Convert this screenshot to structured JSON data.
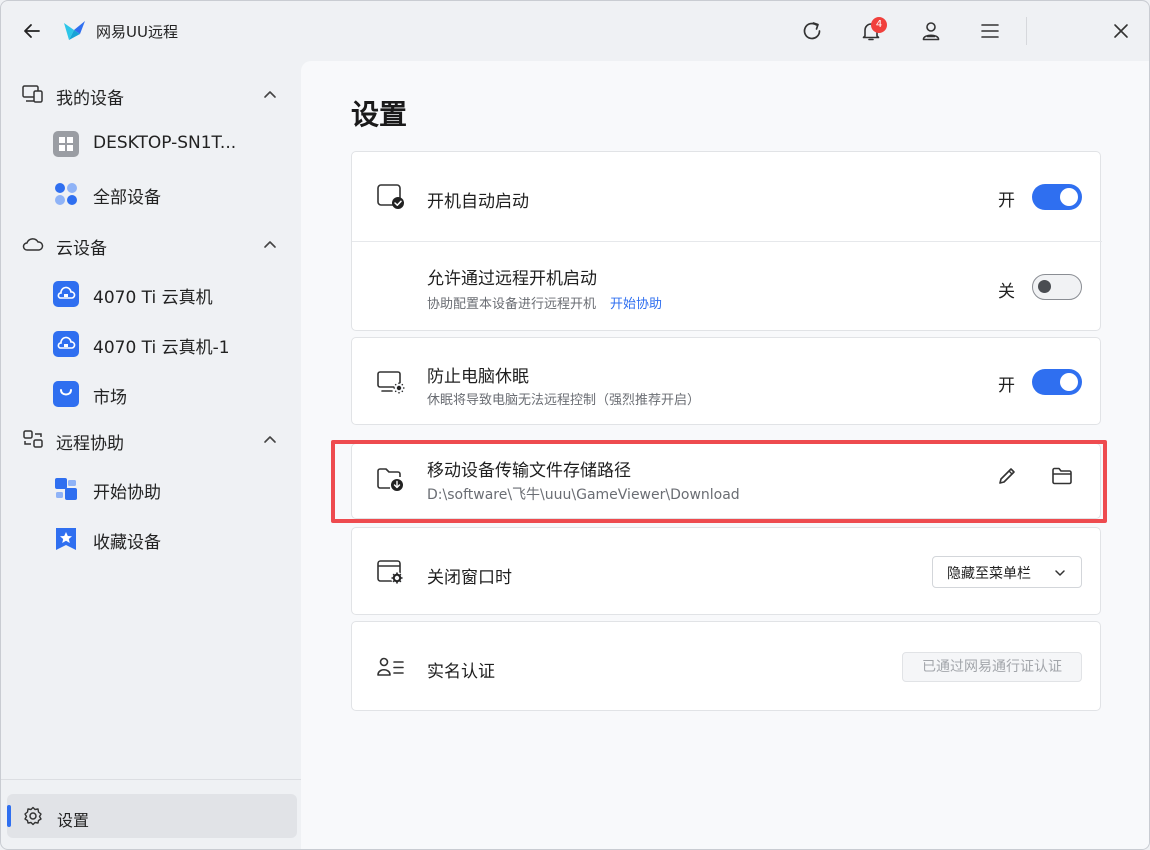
{
  "app": {
    "title": "网易UU远程"
  },
  "titlebar": {
    "notification_count": "4"
  },
  "sidebar": {
    "groups": [
      {
        "label": "我的设备",
        "items": [
          {
            "label": "DESKTOP-SN1T..."
          },
          {
            "label": "全部设备"
          }
        ]
      },
      {
        "label": "云设备",
        "items": [
          {
            "label": "4070 Ti 云真机"
          },
          {
            "label": "4070 Ti 云真机-1"
          },
          {
            "label": "市场"
          }
        ]
      },
      {
        "label": "远程协助",
        "items": [
          {
            "label": "开始协助"
          },
          {
            "label": "收藏设备"
          }
        ]
      }
    ],
    "settings_label": "设置"
  },
  "main": {
    "title": "设置",
    "rows": {
      "autostart": {
        "title": "开机自动启动",
        "state": "开"
      },
      "remote_boot": {
        "title": "允许通过远程开机启动",
        "subtitle": "协助配置本设备进行远程开机",
        "link": "开始协助",
        "state": "关"
      },
      "no_sleep": {
        "title": "防止电脑休眠",
        "subtitle": "休眠将导致电脑无法远程控制（强烈推荐开启）",
        "state": "开"
      },
      "storage_path": {
        "title": "移动设备传输文件存储路径",
        "path": "D:\\software\\飞牛\\uuu\\GameViewer\\Download"
      },
      "close_window": {
        "title": "关闭窗口时",
        "selected": "隐藏至菜单栏"
      },
      "realname": {
        "title": "实名认证",
        "button": "已通过网易通行证认证"
      }
    }
  },
  "colors": {
    "accent": "#2f6ff0",
    "badge": "#f1403c",
    "highlight": "#ee4b4f"
  }
}
